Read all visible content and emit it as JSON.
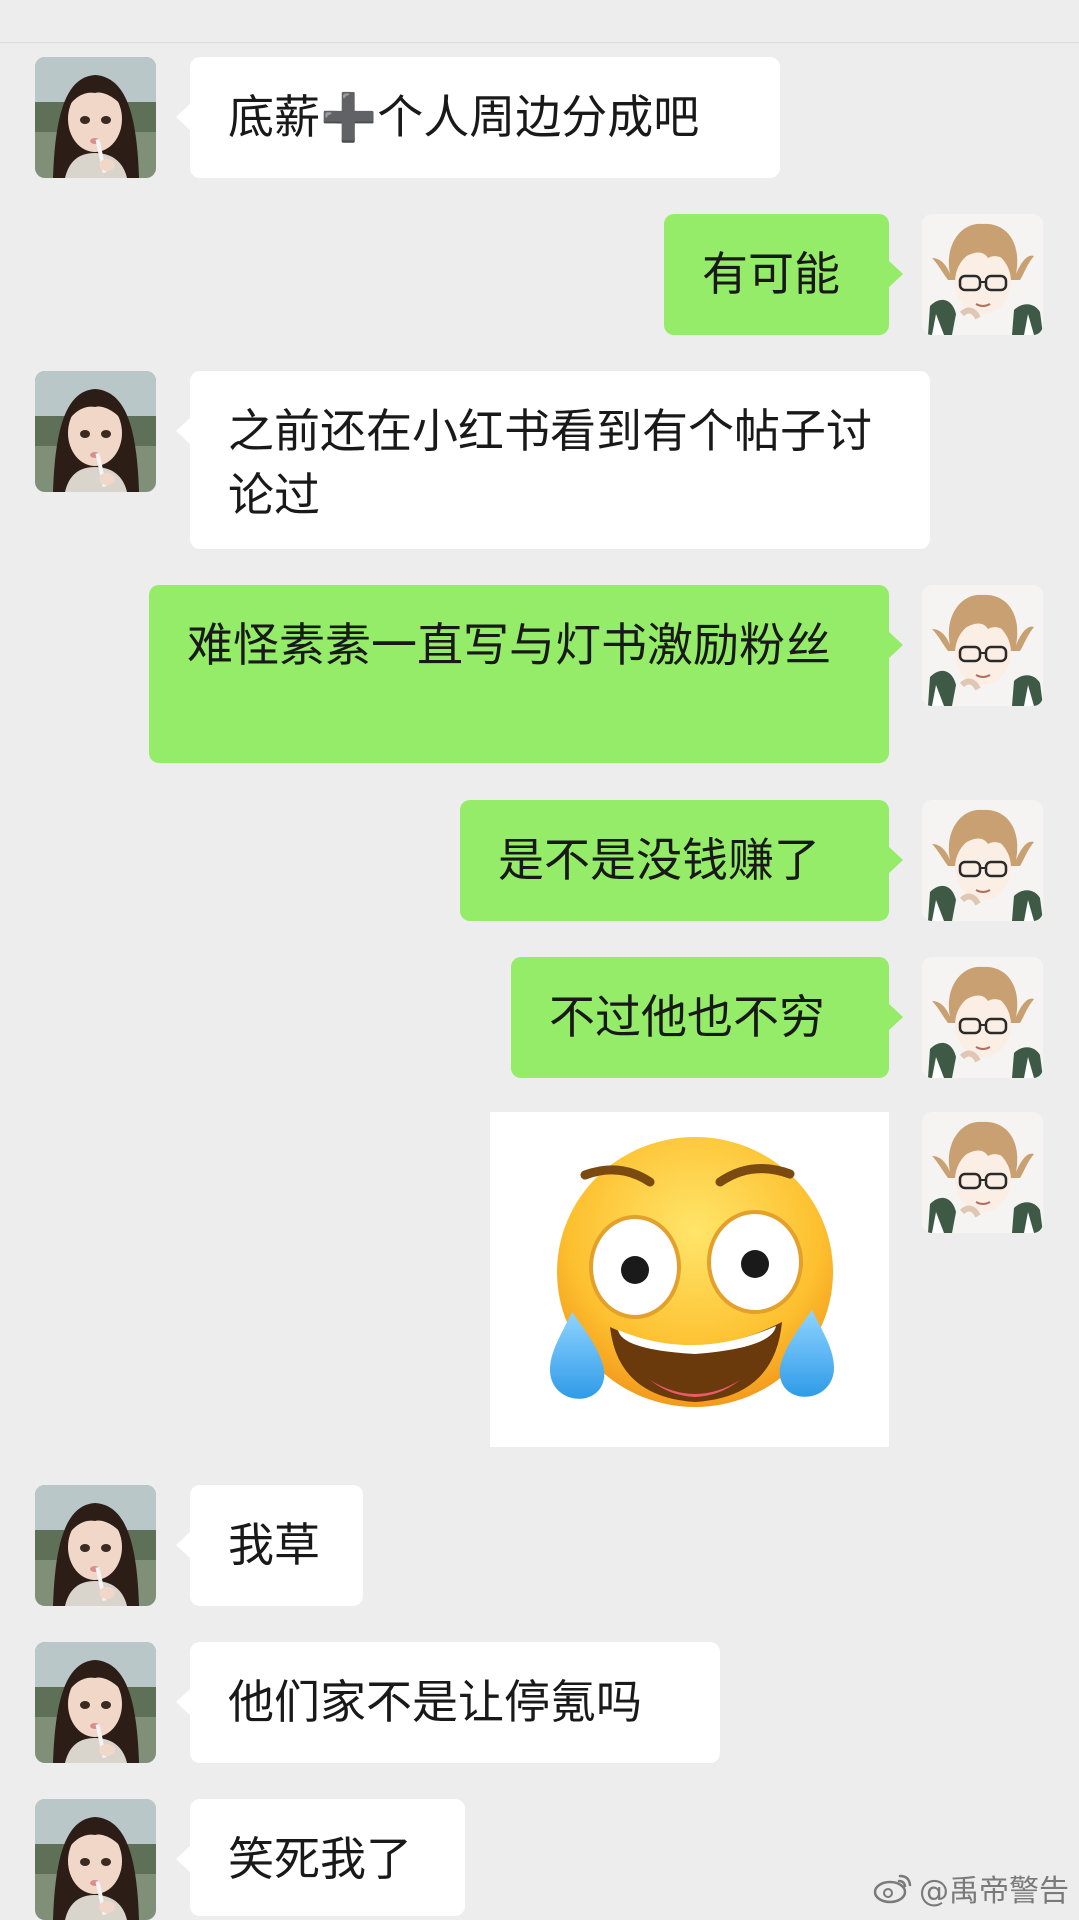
{
  "colors": {
    "background": "#ededed",
    "incoming_bubble": "#ffffff",
    "outgoing_bubble": "#95ec69",
    "text": "#191919"
  },
  "messages": [
    {
      "side": "left",
      "text": "底薪➕个人周边分成吧"
    },
    {
      "side": "right",
      "text": "有可能"
    },
    {
      "side": "left",
      "text": "之前还在小红书看到有个帖子讨论过"
    },
    {
      "side": "right",
      "text": "难怪素素一直写与灯书激励粉丝"
    },
    {
      "side": "right",
      "text": "是不是没钱赚了"
    },
    {
      "side": "right",
      "text": "不过他也不穷"
    },
    {
      "side": "right",
      "sticker": "laughing-crying-emoji"
    },
    {
      "side": "left",
      "text": "我草"
    },
    {
      "side": "left",
      "text": "他们家不是让停氪吗"
    },
    {
      "side": "left",
      "text": "笑死我了"
    }
  ],
  "watermark": {
    "icon": "weibo-icon",
    "text": "@禹帝警告"
  }
}
